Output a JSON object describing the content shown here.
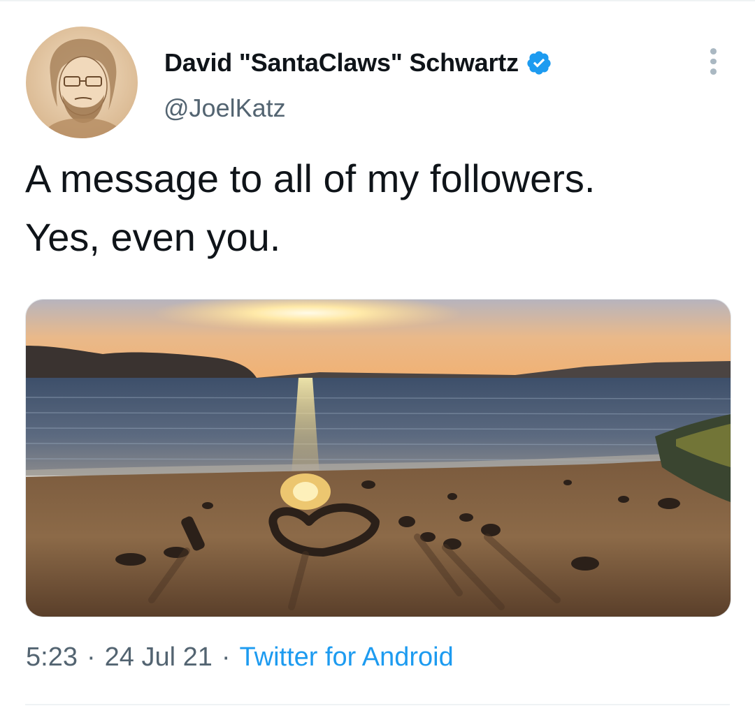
{
  "tweet": {
    "author": {
      "display_name": "David \"SantaClaws\" Schwartz",
      "handle": "@JoelKatz",
      "verified": true,
      "verified_color": "#1d9bf0"
    },
    "text_lines": [
      "A message to all of my followers.",
      "Yes, even you."
    ],
    "media": {
      "type": "photo",
      "subject": "sunset over bay with heart drawn in stones on beach"
    },
    "time": "5:23",
    "date": "24 Jul 21",
    "separator": "·",
    "source": "Twitter for Android",
    "source_color": "#1d9bf0"
  },
  "icons": {
    "verified": "verified-badge-icon",
    "more": "more-options-icon"
  }
}
